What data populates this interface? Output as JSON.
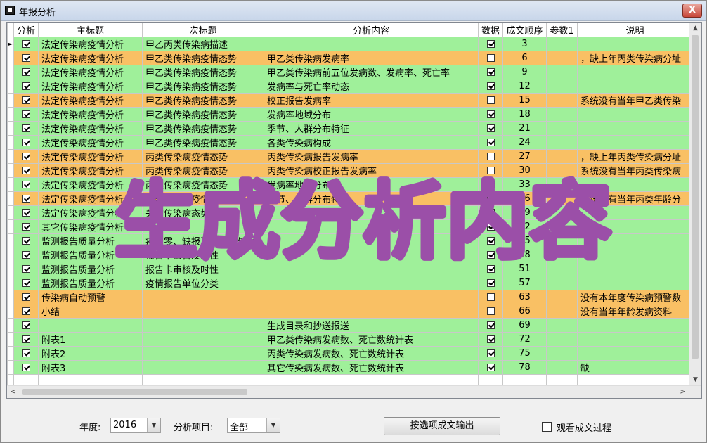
{
  "window": {
    "title": "年报分析",
    "close_label": "X"
  },
  "grid": {
    "columns": [
      "分析",
      "主标题",
      "次标题",
      "分析内容",
      "数据",
      "成文顺序",
      "参数1",
      "说明"
    ],
    "rows": [
      {
        "color": "green",
        "current": true,
        "analyze": true,
        "main": "法定传染病疫情分析",
        "sub": "甲乙丙类传染病描述",
        "content": "",
        "data": true,
        "order": "3",
        "param": "",
        "note": ""
      },
      {
        "color": "orange",
        "analyze": true,
        "main": "法定传染病疫情分析",
        "sub": "甲乙类传染病疫情态势",
        "content": "甲乙类传染病发病率",
        "data": false,
        "order": "6",
        "param": "",
        "note": "，缺上年丙类传染病分址"
      },
      {
        "color": "green",
        "analyze": true,
        "main": "法定传染病疫情分析",
        "sub": "甲乙类传染病疫情态势",
        "content": "甲乙类传染病前五位发病数、发病率、死亡率",
        "data": true,
        "order": "9",
        "param": "",
        "note": ""
      },
      {
        "color": "green",
        "analyze": true,
        "main": "法定传染病疫情分析",
        "sub": "甲乙类传染病疫情态势",
        "content": "发病率与死亡率动态",
        "data": true,
        "order": "12",
        "param": "",
        "note": ""
      },
      {
        "color": "orange",
        "analyze": true,
        "main": "法定传染病疫情分析",
        "sub": "甲乙类传染病疫情态势",
        "content": "校正报告发病率",
        "data": false,
        "order": "15",
        "param": "",
        "note": "系统没有当年甲乙类传染"
      },
      {
        "color": "green",
        "analyze": true,
        "main": "法定传染病疫情分析",
        "sub": "甲乙类传染病疫情态势",
        "content": "发病率地域分布",
        "data": true,
        "order": "18",
        "param": "",
        "note": ""
      },
      {
        "color": "green",
        "analyze": true,
        "main": "法定传染病疫情分析",
        "sub": "甲乙类传染病疫情态势",
        "content": "季节、人群分布特征",
        "data": true,
        "order": "21",
        "param": "",
        "note": ""
      },
      {
        "color": "green",
        "analyze": true,
        "main": "法定传染病疫情分析",
        "sub": "甲乙类传染病疫情态势",
        "content": "各类传染病构成",
        "data": true,
        "order": "24",
        "param": "",
        "note": ""
      },
      {
        "color": "orange",
        "analyze": true,
        "main": "法定传染病疫情分析",
        "sub": "丙类传染病疫情态势",
        "content": "丙类传染病报告发病率",
        "data": false,
        "order": "27",
        "param": "",
        "note": "，缺上年丙类传染病分址"
      },
      {
        "color": "orange",
        "analyze": true,
        "main": "法定传染病疫情分析",
        "sub": "丙类传染病疫情态势",
        "content": "丙类传染病校正报告发病率",
        "data": false,
        "order": "30",
        "param": "",
        "note": "系统没有当年丙类传染病"
      },
      {
        "color": "green",
        "analyze": true,
        "main": "法定传染病疫情分析",
        "sub": "丙类传染病疫情态势",
        "content": "发病率地域分布",
        "data": true,
        "order": "33",
        "param": "",
        "note": ""
      },
      {
        "color": "orange",
        "analyze": true,
        "main": "法定传染病疫情分析",
        "sub": "丙类传染病疫情态势",
        "content": "季节、人群分布特征",
        "data": false,
        "order": "36",
        "param": "",
        "note": "系统没有当年丙类年龄分"
      },
      {
        "color": "green",
        "analyze": true,
        "main": "法定传染病疫情分析",
        "sub": "关注传染病态势",
        "content": "",
        "data": true,
        "order": "39",
        "param": "",
        "note": ""
      },
      {
        "color": "green",
        "analyze": true,
        "main": "其它传染病疫情分析",
        "sub": "",
        "content": "",
        "data": true,
        "order": "42",
        "param": "",
        "note": ""
      },
      {
        "color": "green",
        "analyze": true,
        "main": "监测报告质量分析",
        "sub": "疫情零、缺报及网络参与报",
        "content": "",
        "data": true,
        "order": "45",
        "param": "",
        "note": ""
      },
      {
        "color": "green",
        "analyze": true,
        "main": "监测报告质量分析",
        "sub": "报告卡报告及时性",
        "content": "",
        "data": true,
        "order": "48",
        "param": "",
        "note": ""
      },
      {
        "color": "green",
        "analyze": true,
        "main": "监测报告质量分析",
        "sub": "报告卡审核及时性",
        "content": "",
        "data": true,
        "order": "51",
        "param": "",
        "note": ""
      },
      {
        "color": "green",
        "analyze": true,
        "main": "监测报告质量分析",
        "sub": "疫情报告单位分类",
        "content": "",
        "data": true,
        "order": "57",
        "param": "",
        "note": ""
      },
      {
        "color": "orange",
        "analyze": true,
        "main": "传染病自动预警",
        "sub": "",
        "content": "",
        "data": false,
        "order": "63",
        "param": "",
        "note": "没有本年度传染病预警数"
      },
      {
        "color": "orange",
        "analyze": true,
        "main": "小结",
        "sub": "",
        "content": "",
        "data": false,
        "order": "66",
        "param": "",
        "note": "没有当年年龄发病资料"
      },
      {
        "color": "green",
        "analyze": true,
        "main": "",
        "sub": "",
        "content": "生成目录和抄送报送",
        "data": true,
        "order": "69",
        "param": "",
        "note": ""
      },
      {
        "color": "green",
        "analyze": true,
        "main": "附表1",
        "sub": "",
        "content": "甲乙类传染病发病数、死亡数统计表",
        "data": true,
        "order": "72",
        "param": "",
        "note": ""
      },
      {
        "color": "green",
        "analyze": true,
        "main": "附表2",
        "sub": "",
        "content": "丙类传染病发病数、死亡数统计表",
        "data": true,
        "order": "75",
        "param": "",
        "note": ""
      },
      {
        "color": "green",
        "analyze": true,
        "main": "附表3",
        "sub": "",
        "content": "其它传染病发病数、死亡数统计表",
        "data": true,
        "order": "78",
        "param": "",
        "note": "缺"
      }
    ]
  },
  "watermark": {
    "text": "生成分析内容",
    "color": "#9b4fa8"
  },
  "footer": {
    "year_label": "年度:",
    "year_value": "2016",
    "item_label": "分析项目:",
    "item_value": "全部",
    "generate_button": "按选项成文输出",
    "view_process_label": "观看成文过程"
  },
  "colors": {
    "green": "#9ff09a",
    "orange": "#f9c064"
  }
}
